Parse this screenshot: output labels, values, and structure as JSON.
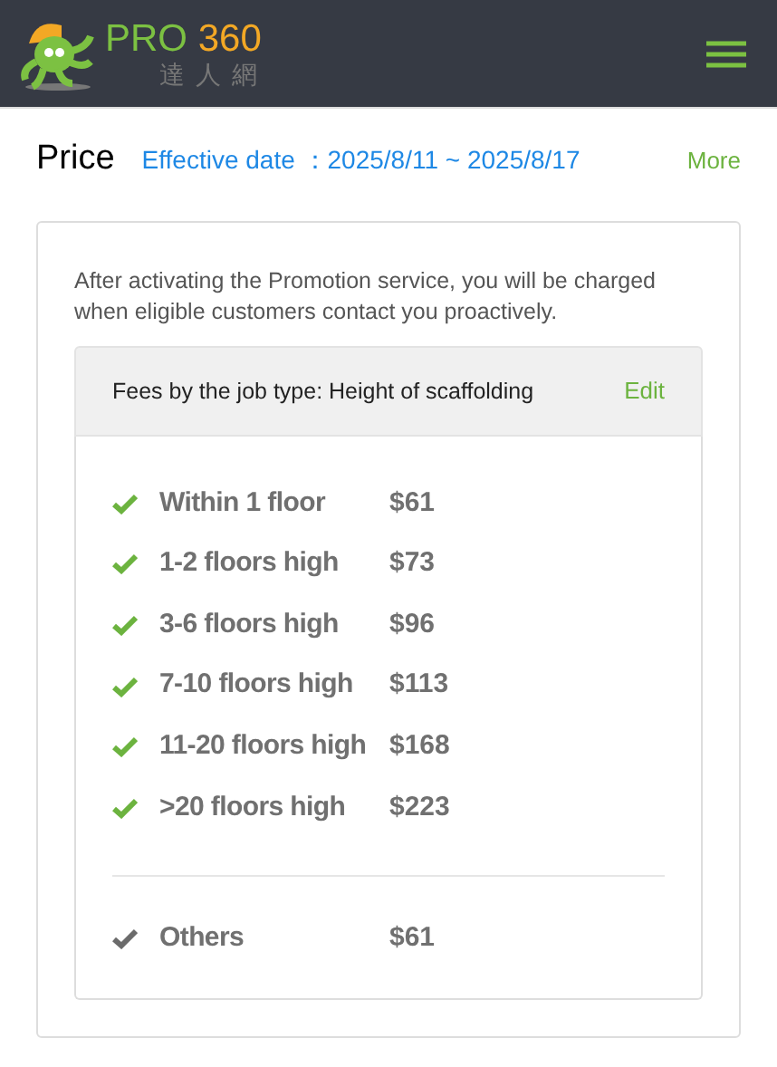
{
  "header": {
    "logo": {
      "part_1": "PRO",
      "part_2": "360",
      "subtitle": "達人網"
    }
  },
  "price": {
    "title": "Price",
    "effective_label": "Effective date",
    "effective_range": "：2025/8/11 ~ 2025/8/17",
    "more": "More"
  },
  "card": {
    "notice": "After activating the Promotion service, you will be charged when eligible customers contact you proactively.",
    "fees_title": "Fees by the job type: Height of scaffolding",
    "edit": "Edit",
    "tiers": [
      {
        "label": "Within 1 floor",
        "price": "$61",
        "selected": true
      },
      {
        "label": "1-2 floors high",
        "price": "$73",
        "selected": true
      },
      {
        "label": "3-6 floors high",
        "price": "$96",
        "selected": true
      },
      {
        "label": "7-10 floors high",
        "price": "$113",
        "selected": true
      },
      {
        "label": "11-20 floors high",
        "price": "$168",
        "selected": true
      },
      {
        "label": ">20 floors high",
        "price": "$223",
        "selected": true
      }
    ],
    "others": [
      {
        "label": "Others",
        "price": "$61",
        "selected": false
      }
    ]
  }
}
